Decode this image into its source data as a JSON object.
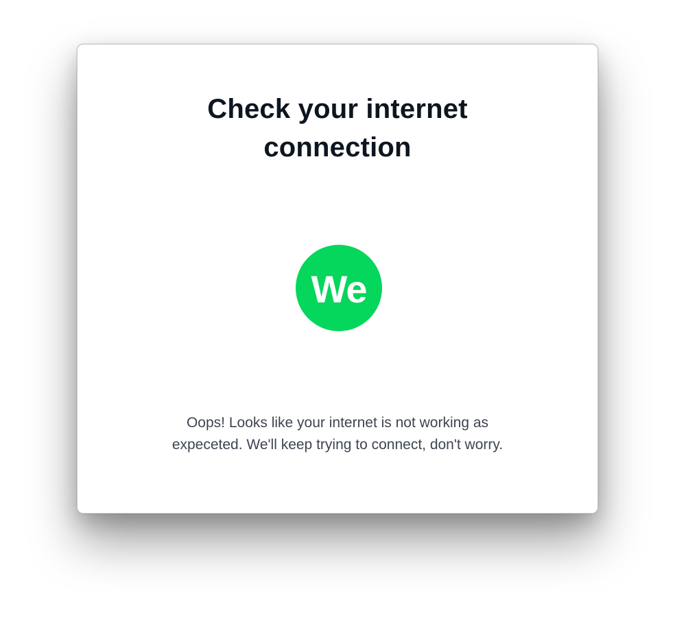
{
  "dialog": {
    "title_lines": [
      "Check your internet",
      "connection"
    ],
    "logo_text": "We",
    "message_lines": [
      "Oops! Looks like your internet is not working as",
      "expeceted. We'll keep trying to connect, don't worry."
    ]
  },
  "colors": {
    "brand_green": "#05d65c",
    "title_text": "#0d1520",
    "body_text": "#3d4450",
    "background": "#ffffff"
  },
  "icons": {
    "logo": "we-logo-icon"
  }
}
